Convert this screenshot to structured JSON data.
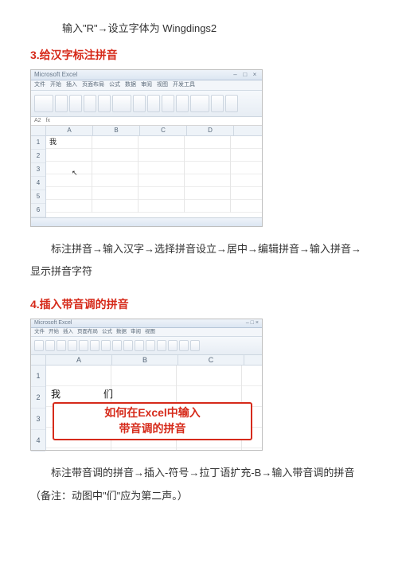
{
  "intro_line": "输入\"R\"→设立字体为 Wingdings2",
  "heading3": "3.给汉字标注拼音",
  "heading4": "4.插入带音调的拼音",
  "para3": "标注拼音→输入汉字→选择拼音设立→居中→编辑拼音→输入拼音→显示拼音字符",
  "para4": "标注带音调的拼音→插入-符号→拉丁语扩充-B→输入带音调的拼音（备注：动图中\"们\"应为第二声。）",
  "shot1": {
    "title": "Microsoft Excel",
    "menus": [
      "文件",
      "开始",
      "插入",
      "页面布局",
      "公式",
      "数据",
      "审阅",
      "视图",
      "开发工具"
    ],
    "cols": [
      "",
      "A",
      "B",
      "C",
      "D"
    ],
    "rows": [
      "1",
      "2",
      "3",
      "4",
      "5",
      "6"
    ],
    "cell_a2": "我",
    "fx": "fx"
  },
  "shot2": {
    "title": "Microsoft Excel",
    "menus": [
      "文件",
      "开始",
      "插入",
      "页面布局",
      "公式",
      "数据",
      "审阅",
      "视图"
    ],
    "cols": [
      "",
      "A",
      "B",
      "C"
    ],
    "rows": [
      "1",
      "2",
      "3",
      "4"
    ],
    "chars": "我们",
    "overlay_line1": "如何在Excel中输入",
    "overlay_line2": "带音调的拼音"
  }
}
